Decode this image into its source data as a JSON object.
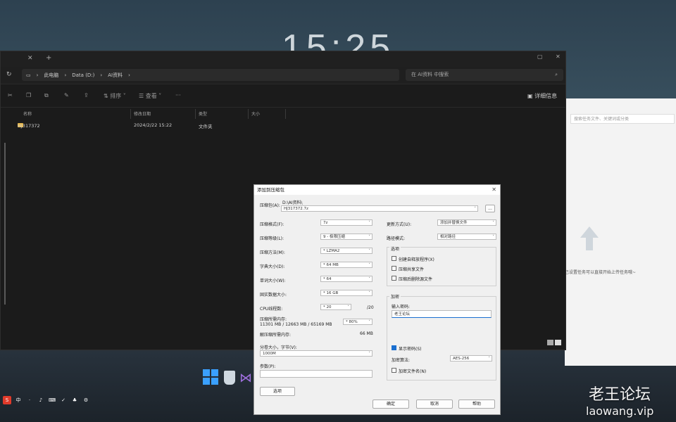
{
  "desktop": {
    "clock": "15:25"
  },
  "explorer": {
    "tab_add": "+",
    "path": [
      "此电脑",
      "Data (D:)",
      "AI资料"
    ],
    "search_placeholder": "在 AI资料 中搜索",
    "commands": {
      "sort": "排序",
      "view": "查看",
      "more": "···",
      "details": "详细信息"
    },
    "columns": [
      "名称",
      "修改日期",
      "类型",
      "大小"
    ],
    "rows": [
      {
        "name": "HJ317372",
        "date": "2024/2/22 15:22",
        "type": "文件夹",
        "size": ""
      }
    ]
  },
  "right_app": {
    "search_placeholder": "搜索任务文件、关键词或分类",
    "hint": "已设置任务可以直接开始上传任务哦~"
  },
  "dialog": {
    "title": "添加到压缩包",
    "archive_name_label": "压缩包(A):",
    "dir_label": "D:\\AI资料\\",
    "archive_name": "HJ317372.7z",
    "browse": "...",
    "format_label": "压缩格式(F):",
    "format": "7z",
    "level_label": "压缩等级(L):",
    "level": "9 - 极限压缩",
    "method_label": "压缩方法(M):",
    "method": "* LZMA2",
    "dict_label": "字典大小(D):",
    "dict": "* 64 MB",
    "word_label": "单词大小(W):",
    "word": "* 64",
    "solid_label": "固实数据大小:",
    "solid": "* 16 GB",
    "cpu_label": "CPU线程数:",
    "cpu": "* 20",
    "cpu_total": "/20",
    "mem_label": "压缩所需内存:",
    "mem_detail": "11301 MB / 12663 MB / 65169 MB",
    "mem_pct": "* 80%",
    "decomp_label": "解压缩所需内存:",
    "decomp_val": "66 MB",
    "split_label": "分卷大小，字节(V):",
    "split_val": "1000M",
    "params_label": "参数(P):",
    "options_btn": "选项",
    "update_label": "更新方式(U):",
    "update": "添加并替换文件",
    "path_label": "路径模式:",
    "path_mode": "相对路径",
    "options_group": "选项",
    "opt1": "创建自释放程序(X)",
    "opt2": "压缩共享文件",
    "opt3": "压缩后删除源文件",
    "enc_group": "加密",
    "pwd_label": "输入密码:",
    "pwd_value": "老王论坛",
    "show_pwd": "显示密码(S)",
    "enc_method_label": "加密算法:",
    "enc_method": "AES-256",
    "enc_names": "加密文件名(N)",
    "ok": "确定",
    "cancel": "取消",
    "help": "帮助"
  },
  "watermark": {
    "cn": "老王论坛",
    "url": "laowang.vip"
  }
}
